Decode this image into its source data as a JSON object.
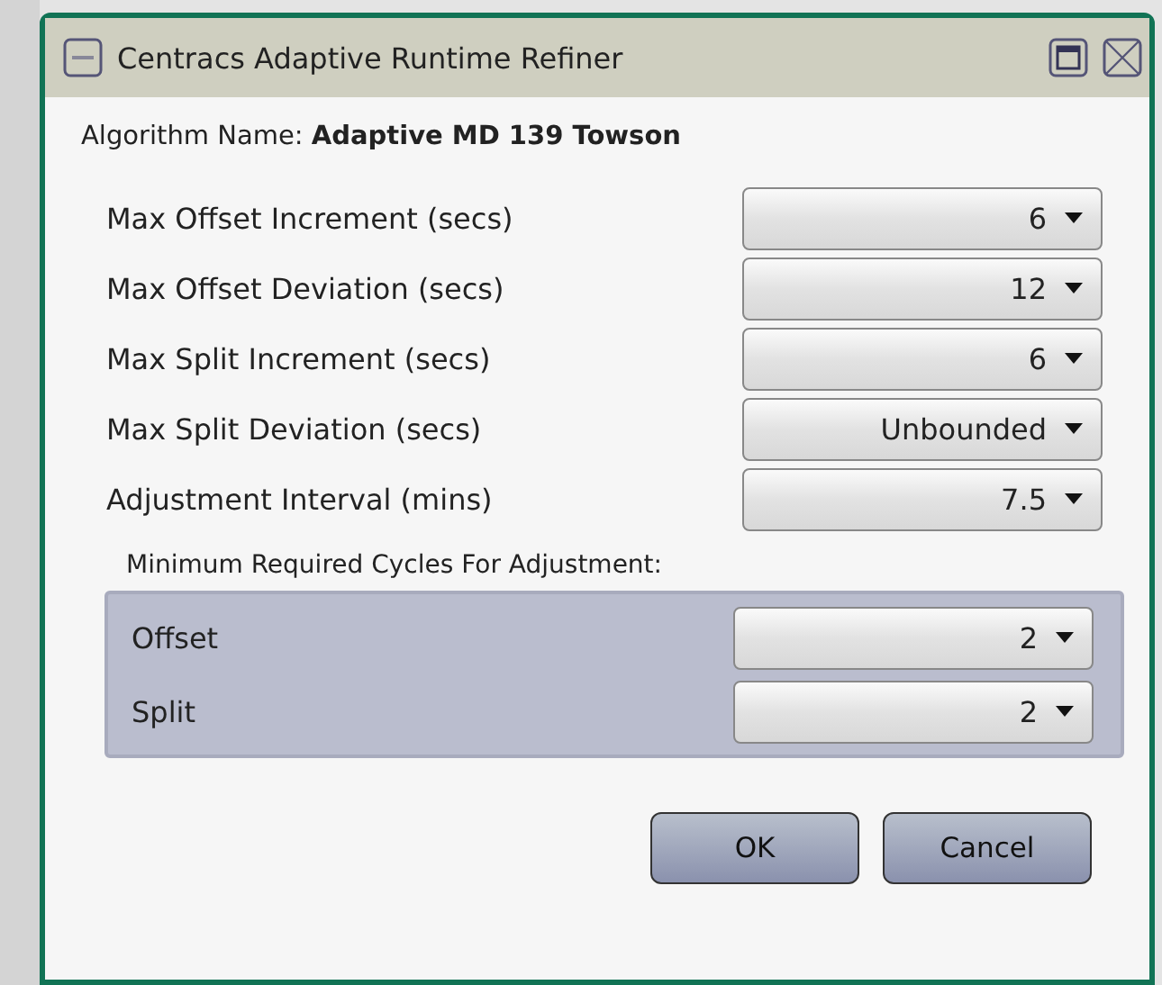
{
  "window": {
    "title": "Centracs Adaptive Runtime Refiner"
  },
  "algorithm": {
    "label": "Algorithm Name:",
    "value": "Adaptive MD 139 Towson"
  },
  "settings": [
    {
      "label": "Max Offset Increment (secs)",
      "value": "6"
    },
    {
      "label": "Max Offset Deviation (secs)",
      "value": "12"
    },
    {
      "label": "Max Split Increment (secs)",
      "value": "6"
    },
    {
      "label": "Max Split Deviation (secs)",
      "value": "Unbounded"
    },
    {
      "label": "Adjustment Interval (mins)",
      "value": "7.5"
    }
  ],
  "cycles": {
    "title": "Minimum Required Cycles For Adjustment:",
    "rows": [
      {
        "label": "Offset",
        "value": "2"
      },
      {
        "label": "Split",
        "value": "2"
      }
    ]
  },
  "buttons": [
    {
      "label": "OK"
    },
    {
      "label": "Cancel"
    }
  ]
}
